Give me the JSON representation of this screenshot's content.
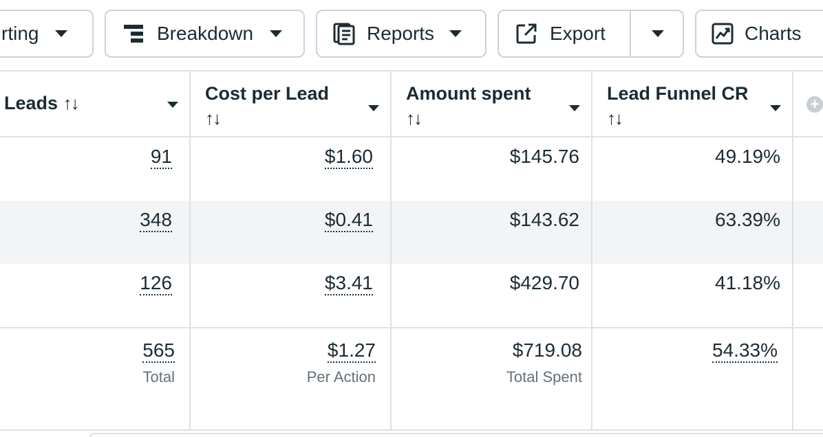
{
  "toolbar": {
    "reporting_label": "rting",
    "breakdown_label": "Breakdown",
    "reports_label": "Reports",
    "export_label": "Export",
    "charts_label": "Charts"
  },
  "table": {
    "columns": [
      {
        "label": "Leads",
        "sort": "↑↓"
      },
      {
        "label": "Cost per Lead",
        "sort": "↑↓"
      },
      {
        "label": "Amount spent",
        "sort": "↑↓"
      },
      {
        "label": "Lead Funnel CR",
        "sort": "↑↓"
      }
    ],
    "rows": [
      {
        "leads": "91",
        "cpl": "$1.60",
        "spent": "$145.76",
        "cr": "49.19%"
      },
      {
        "leads": "348",
        "cpl": "$0.41",
        "spent": "$143.62",
        "cr": "63.39%"
      },
      {
        "leads": "126",
        "cpl": "$3.41",
        "spent": "$429.70",
        "cr": "41.18%"
      }
    ],
    "totals": {
      "leads": "565",
      "leads_sub": "Total",
      "cpl": "$1.27",
      "cpl_sub": "Per Action",
      "spent": "$719.08",
      "spent_sub": "Total Spent",
      "cr": "54.33%"
    }
  },
  "colors": {
    "text": "#1c2b33",
    "border": "#cbd2d9",
    "row_highlight": "#f2f4f5",
    "subtext": "#65717a"
  },
  "icons": [
    "caret-down-icon",
    "breakdown-icon",
    "reports-icon",
    "export-icon",
    "charts-icon",
    "add-column-icon"
  ]
}
